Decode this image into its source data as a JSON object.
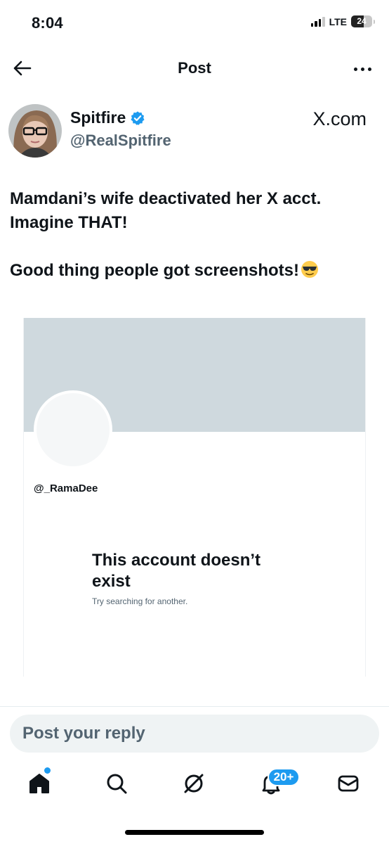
{
  "status_bar": {
    "time": "8:04",
    "network": "LTE",
    "battery": "24"
  },
  "header": {
    "title": "Post"
  },
  "author": {
    "name": "Spitfire",
    "handle": "@RealSpitfire",
    "source": "X.com",
    "verified": true
  },
  "post": {
    "line1": "Mamdani’s wife deactivated her X acct. Imagine THAT!",
    "line2": "Good thing people got screenshots!"
  },
  "embedded_screenshot": {
    "handle": "@_RamaDee",
    "title": "This account doesn’t exist",
    "subtitle": "Try searching for another."
  },
  "reply": {
    "placeholder": "Post your reply"
  },
  "tabbar": {
    "notifications_badge": "20+"
  },
  "colors": {
    "accent": "#1d9bf0",
    "banner": "#cfd9de",
    "secondary_text": "#536471"
  }
}
